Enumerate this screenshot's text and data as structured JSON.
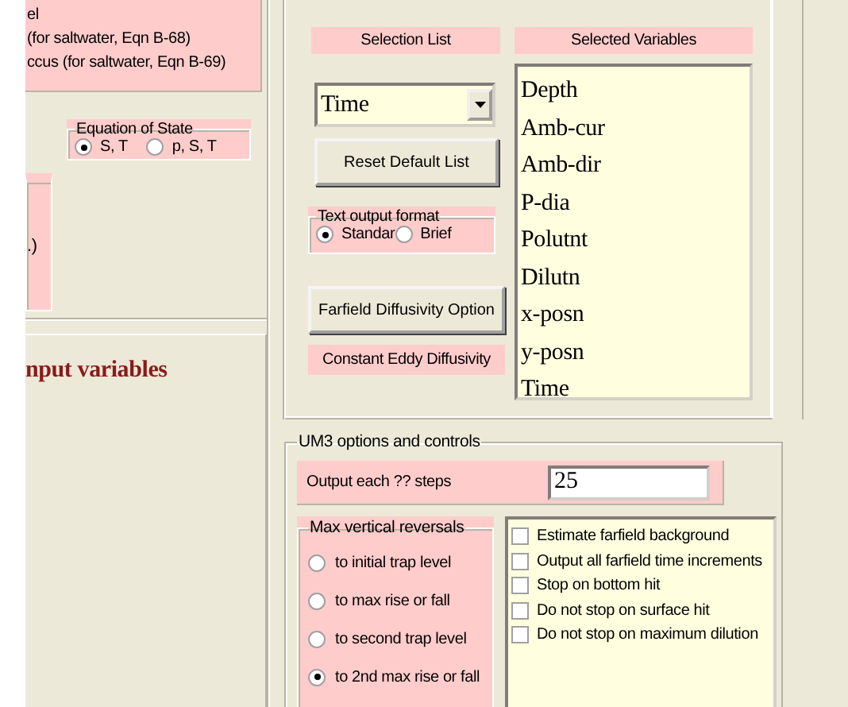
{
  "left_panel": {
    "formula_lines": [
      "el",
      "(for saltwater, Eqn B-68)",
      "ccus (for saltwater, Eqn B-69)"
    ],
    "equation_of_state": {
      "title": "Equation of State",
      "options": [
        {
          "label": "S, T",
          "selected": true
        },
        {
          "label": "p, S, T",
          "selected": false
        }
      ]
    },
    "cut_box_text": ".)",
    "section_heading": "nput variables"
  },
  "output_panel": {
    "selection_list_label": "Selection List",
    "selected_variables_label": "Selected Variables",
    "dropdown": {
      "value": "Time"
    },
    "reset_button": "Reset Default List",
    "text_output_format": {
      "title": "Text output format",
      "options": [
        {
          "label": "Standar",
          "selected": true
        },
        {
          "label": "Brief",
          "selected": false
        }
      ]
    },
    "farfield_button": "Farfield Diffusivity Option",
    "diffusivity_label": "Constant Eddy Diffusivity",
    "selected_variables": [
      "Depth",
      "Amb-cur",
      "Amb-dir",
      "P-dia",
      "Polutnt",
      "Dilutn",
      "x-posn",
      "y-posn",
      "Time"
    ]
  },
  "um3": {
    "title": "UM3 options and controls",
    "output_steps": {
      "label": "Output each ?? steps",
      "value": "25"
    },
    "max_vertical_reversals": {
      "title": "Max vertical reversals",
      "options": [
        {
          "label": "to initial trap level",
          "selected": false
        },
        {
          "label": "to max rise or fall",
          "selected": false
        },
        {
          "label": "to second trap level",
          "selected": false
        },
        {
          "label": "to 2nd max rise or fall",
          "selected": true
        }
      ]
    },
    "checkboxes": [
      {
        "label": "Estimate farfield background",
        "checked": false
      },
      {
        "label": "Output all farfield time increments",
        "checked": false
      },
      {
        "label": "Stop on bottom hit",
        "checked": false
      },
      {
        "label": "Do not stop on surface hit",
        "checked": false
      },
      {
        "label": "Do not stop on maximum dilution",
        "checked": false
      }
    ]
  }
}
